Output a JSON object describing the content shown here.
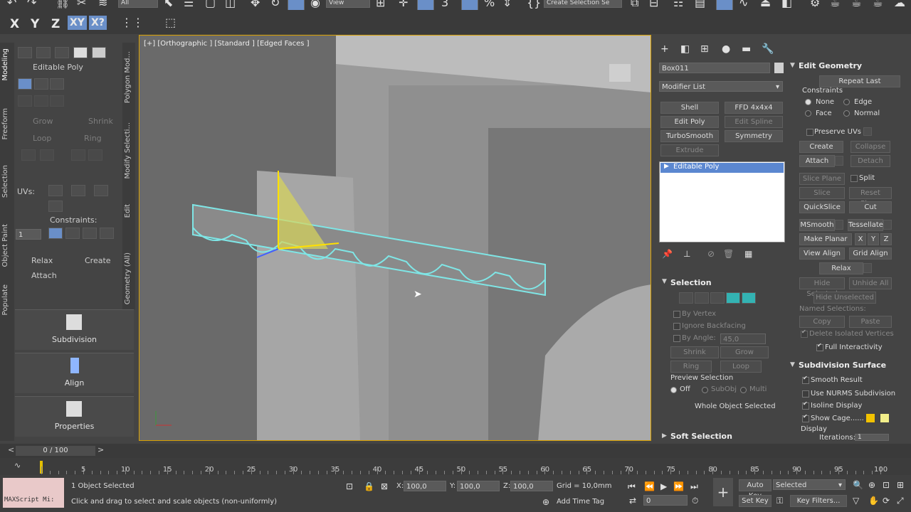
{
  "toolbar": {
    "selection_filter": "All",
    "view_dropdown": "View",
    "named_selection": "Create Selection Se",
    "axis_x": "X",
    "axis_y": "Y",
    "axis_z": "Z",
    "axis_xy": "XY",
    "axis_xy2": "X?"
  },
  "ribbon": {
    "vertical_tabs": [
      "Modeling",
      "Freeform",
      "Selection",
      "Object Paint",
      "Populate"
    ],
    "panel_tabs": [
      "Polygon Mod...",
      "Modify Selecti...",
      "Edit",
      "Geometry (All)"
    ],
    "title": "Editable Poly",
    "grow": "Grow",
    "shrink": "Shrink",
    "loop": "Loop",
    "ring": "Ring",
    "uvs": "UVs:",
    "constraints": "Constraints:",
    "uvs_value": "1",
    "relax": "Relax",
    "create": "Create",
    "attach": "Attach",
    "subdivision": "Subdivision",
    "align": "Align",
    "properties": "Properties"
  },
  "viewport": {
    "label": "[+] [Orthographic ] [Standard ] [Edged Faces ]"
  },
  "command_panel": {
    "object_name": "Box011",
    "modifier_list": "Modifier List",
    "modifier_buttons": [
      "Shell",
      "FFD 4x4x4",
      "Edit Poly",
      "Edit Spline",
      "TurboSmooth",
      "Symmetry",
      "Extrude"
    ],
    "stack_item": "Editable Poly",
    "selection_header": "Selection",
    "by_vertex": "By Vertex",
    "ignore_backfacing": "Ignore Backfacing",
    "by_angle": "By Angle:",
    "by_angle_value": "45,0",
    "shrink": "Shrink",
    "grow": "Grow",
    "ring": "Ring",
    "loop": "Loop",
    "preview_selection": "Preview Selection",
    "preview_off": "Off",
    "preview_subobj": "SubObj",
    "preview_multi": "Multi",
    "whole_object": "Whole Object Selected",
    "soft_selection": "Soft Selection"
  },
  "edit_geometry": {
    "header": "Edit Geometry",
    "repeat_last": "Repeat Last",
    "constraints": "Constraints",
    "none": "None",
    "edge": "Edge",
    "face": "Face",
    "normal": "Normal",
    "preserve_uvs": "Preserve UVs",
    "create": "Create",
    "collapse": "Collapse",
    "attach": "Attach",
    "detach": "Detach",
    "slice_plane": "Slice Plane",
    "split": "Split",
    "slice": "Slice",
    "reset_plane": "Reset Plane",
    "quickslice": "QuickSlice",
    "cut": "Cut",
    "msmooth": "MSmooth",
    "tessellate": "Tessellate",
    "make_planar": "Make Planar",
    "x": "X",
    "y": "Y",
    "z": "Z",
    "view_align": "View Align",
    "grid_align": "Grid Align",
    "relax": "Relax",
    "hide_selected": "Hide Selected",
    "unhide_all": "Unhide All",
    "hide_unselected": "Hide Unselected",
    "named_selections": "Named Selections:",
    "copy": "Copy",
    "paste": "Paste",
    "delete_isolated": "Delete Isolated Vertices",
    "full_interactivity": "Full Interactivity"
  },
  "subdivision_surface": {
    "header": "Subdivision Surface",
    "smooth_result": "Smooth Result",
    "use_nurms": "Use NURMS Subdivision",
    "isoline_display": "Isoline Display",
    "show_cage": "Show Cage......",
    "display": "Display",
    "iterations": "Iterations:",
    "iterations_value": "1",
    "cage_color1": "#f2c200",
    "cage_color2": "#f2ee8a"
  },
  "timeline": {
    "frame_counter": "0 / 100",
    "ticks": [
      "5",
      "10",
      "15",
      "20",
      "25",
      "30",
      "35",
      "40",
      "45",
      "50",
      "55",
      "60",
      "65",
      "70",
      "75",
      "80",
      "85",
      "90",
      "95",
      "100"
    ]
  },
  "status": {
    "maxscript": "MAXScript Mi:",
    "objects_selected": "1 Object Selected",
    "prompt": "Click and drag to select and scale objects (non-uniformly)",
    "x_label": "X:",
    "x_value": "100,0",
    "y_label": "Y:",
    "y_value": "100,0",
    "z_label": "Z:",
    "z_value": "100,0",
    "grid": "Grid = 10,0mm",
    "add_time_tag": "Add Time Tag",
    "frame_value": "0",
    "auto_key": "Auto Key",
    "selected": "Selected",
    "set_key": "Set Key",
    "key_filters": "Key Filters..."
  }
}
